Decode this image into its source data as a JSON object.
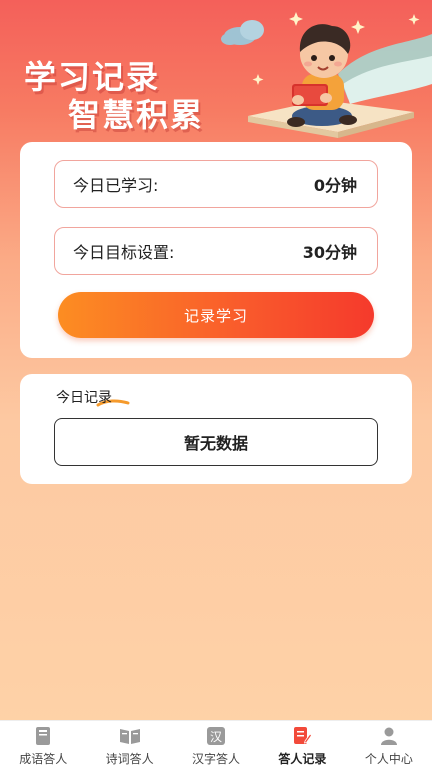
{
  "hero": {
    "title_line1": "学习记录",
    "title_line2": "智慧积累"
  },
  "stats": {
    "today_learned_label": "今日已学习:",
    "today_learned_value": "0分钟",
    "goal_label": "今日目标设置:",
    "goal_value": "30分钟"
  },
  "actions": {
    "record_label": "记录学习"
  },
  "today": {
    "title": "今日记录",
    "empty_text": "暂无数据"
  },
  "tabbar": {
    "items": [
      {
        "label": "成语答人",
        "icon": "book-icon"
      },
      {
        "label": "诗词答人",
        "icon": "open-book-icon"
      },
      {
        "label": "汉字答人",
        "icon": "han-character-icon"
      },
      {
        "label": "答人记录",
        "icon": "record-edit-icon",
        "active": true
      },
      {
        "label": "个人中心",
        "icon": "person-icon"
      }
    ],
    "active_color": "#f24a3a",
    "inactive_color": "#9a9a9a"
  },
  "colors": {
    "accent_start": "#fc8d22",
    "accent_end": "#f53a2c",
    "border_pink": "#f1a59d"
  }
}
